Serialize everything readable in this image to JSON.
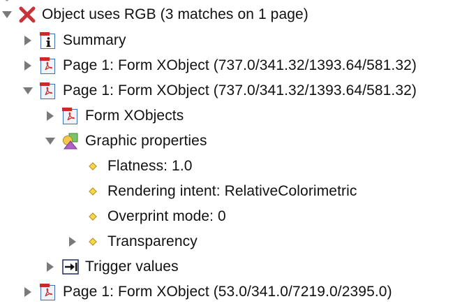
{
  "colors": {
    "arrow": "#7a7a7a",
    "error_red": "#c8323a",
    "doc_border": "#3f6fb0",
    "pdf_red": "#cc2a2a",
    "diamond_fill": "#f5d94a",
    "diamond_stroke": "#b7952a",
    "graphics_purple": "#b061c9"
  },
  "tree": {
    "root": {
      "label": "Object uses RGB (3 matches on 1 page)",
      "icon": "error-x-icon",
      "state": "expanded"
    },
    "summary": {
      "label": "Summary",
      "icon": "info-document-icon",
      "state": "collapsed"
    },
    "page_form_1": {
      "label": "Page 1: Form XObject (737.0/341.32/1393.64/581.32)",
      "icon": "pdf-document-icon",
      "state": "collapsed"
    },
    "page_form_2": {
      "label": "Page 1: Form XObject (737.0/341.32/1393.64/581.32)",
      "icon": "pdf-document-icon",
      "state": "expanded"
    },
    "form_xobjects": {
      "label": "Form XObjects",
      "icon": "pdf-document-icon",
      "state": "collapsed"
    },
    "graphic_properties": {
      "label": "Graphic properties",
      "icon": "graphic-shapes-icon",
      "state": "expanded"
    },
    "flatness": {
      "label": "Flatness: 1.0",
      "icon": "property-diamond-icon"
    },
    "rendering_intent": {
      "label": "Rendering intent: RelativeColorimetric",
      "icon": "property-diamond-icon"
    },
    "overprint_mode": {
      "label": "Overprint mode: 0",
      "icon": "property-diamond-icon"
    },
    "transparency": {
      "label": "Transparency",
      "icon": "property-diamond-icon",
      "state": "collapsed"
    },
    "trigger_values": {
      "label": "Trigger values",
      "icon": "trigger-arrow-icon",
      "state": "collapsed"
    },
    "page_form_3": {
      "label": "Page 1: Form XObject (53.0/341.0/7219.0/2395.0)",
      "icon": "pdf-document-icon",
      "state": "collapsed"
    }
  }
}
